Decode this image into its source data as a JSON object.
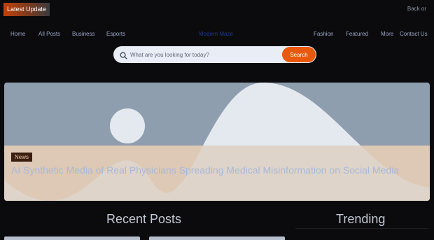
{
  "topbar": {
    "latest_label": "Latest Update",
    "back_label": "Back or"
  },
  "nav": {
    "home": "Home",
    "all_posts": "All Posts",
    "business": "Business",
    "esports": "Esports",
    "brand": "Modern Maze",
    "fashion": "Fashion",
    "featured": "Featured",
    "more": "More",
    "contact": "Contact Us"
  },
  "search": {
    "placeholder": "What are you looking for today?",
    "button_label": "Search"
  },
  "hero": {
    "tag": "News",
    "title": "AI Synthetic Media of Real Physicians Spreading Medical Misinformation on Social Media"
  },
  "sections": {
    "recent_posts": "Recent Posts",
    "trending": "Trending"
  },
  "colors": {
    "background": "#0b0b0e",
    "accent": "#ea580c",
    "brand": "#1e3a8a",
    "search_bg": "#e8edf6",
    "hero_sky": "#8f9eae",
    "hero_ground": "#e2d1c0"
  },
  "icons": {
    "search": "search-icon",
    "hero_image": "image-placeholder-icon"
  }
}
